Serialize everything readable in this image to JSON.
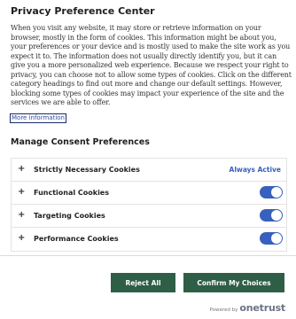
{
  "header": {
    "title": "Privacy Preference Center"
  },
  "description": {
    "text": "When you visit any website, it may store or retrieve information on your browser, mostly in the form of cookies. This information might be about you, your preferences or your device and is mostly used to make the site work as you expect it to. The information does not usually directly identify you, but it can give you a more personalized web experience. Because we respect your right to privacy, you can choose not to allow some types of cookies. Click on the different category headings to find out more and change our default settings. However, blocking some types of cookies may impact your experience of the site and the services we are able to offer.",
    "more_info": "More information"
  },
  "consent": {
    "title": "Manage Consent Preferences",
    "items": [
      {
        "label": "Strictly Necessary Cookies",
        "status": "Always Active",
        "expand_icon": "plus-icon"
      },
      {
        "label": "Functional Cookies",
        "enabled": true,
        "expand_icon": "plus-icon"
      },
      {
        "label": "Targeting Cookies",
        "enabled": true,
        "expand_icon": "plus-icon"
      },
      {
        "label": "Performance Cookies",
        "enabled": true,
        "expand_icon": "plus-icon"
      }
    ],
    "plus_glyph": "+"
  },
  "buttons": {
    "reject_all": "Reject All",
    "confirm": "Confirm My Choices"
  },
  "footer": {
    "powered_by": "Powered by",
    "brand": "onetrust"
  },
  "colors": {
    "accent": "#3860be",
    "button": "#2f5e46",
    "text": "#1f1f1f"
  }
}
